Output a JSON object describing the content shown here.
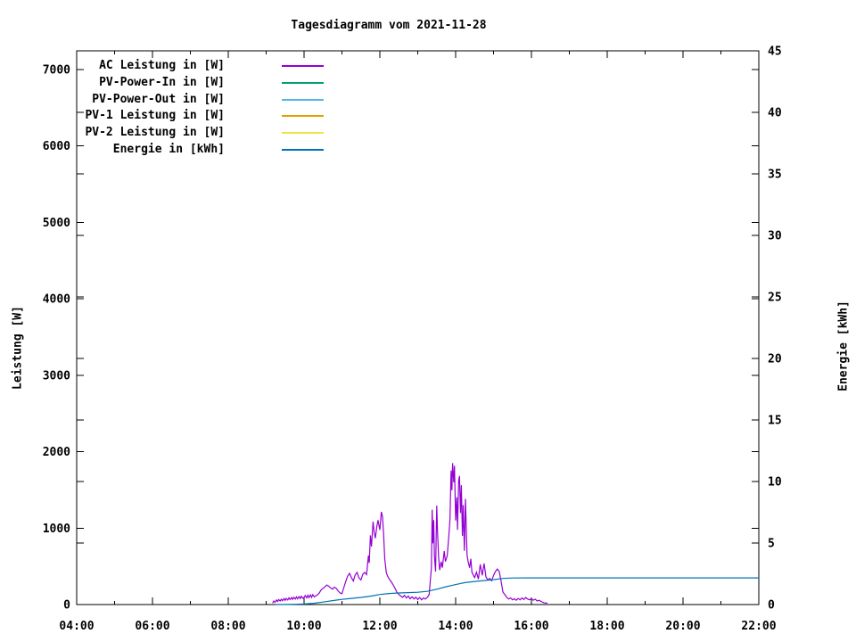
{
  "chart": {
    "title": "Tagesdiagramm vom 2021-11-28",
    "ylabel": "Leistung [W]",
    "y2label": "Energie [kWh]"
  },
  "chart_data": {
    "type": "line",
    "title": "Tagesdiagramm vom 2021-11-28",
    "xlabel": "",
    "ylabel": "Leistung [W]",
    "y2label": "Energie [kWh]",
    "x_axis": {
      "min_h": 4,
      "max_h": 22,
      "major_step_h": 2,
      "minor_step_h": 1,
      "tick_labels": [
        "04:00",
        "06:00",
        "08:00",
        "10:00",
        "12:00",
        "14:00",
        "16:00",
        "18:00",
        "20:00",
        "22:00"
      ]
    },
    "y_axis": {
      "min": 0,
      "max": 7245,
      "tick_step": 1000,
      "tick_labels": [
        "0",
        "1000",
        "2000",
        "3000",
        "4000",
        "5000",
        "6000",
        "7000"
      ],
      "tick_values": [
        0,
        1000,
        2000,
        3000,
        4000,
        5000,
        6000,
        7000
      ]
    },
    "y2_axis": {
      "min": 0,
      "max": 45,
      "tick_step": 5,
      "tick_labels": [
        "0",
        "5",
        "10",
        "15",
        "20",
        "25",
        "30",
        "35",
        "40",
        "45"
      ],
      "tick_values": [
        0,
        5,
        10,
        15,
        20,
        25,
        30,
        35,
        40,
        45
      ]
    },
    "grid": false,
    "legend_position": "top-left-inside",
    "legend": [
      {
        "label": "AC Leistung in [W]",
        "color": "#9400d3"
      },
      {
        "label": "PV-Power-In in [W]",
        "color": "#009e73"
      },
      {
        "label": "PV-Power-Out in [W]",
        "color": "#56b4e9"
      },
      {
        "label": "PV-1 Leistung in [W]",
        "color": "#e69f00"
      },
      {
        "label": "PV-2 Leistung in [W]",
        "color": "#f0e442"
      },
      {
        "label": "Energie in [kWh]",
        "color": "#0072b2"
      }
    ],
    "series": [
      {
        "name": "AC Leistung in [W]",
        "color": "#9400d3",
        "axis": "y1",
        "points": [
          [
            9.17,
            20
          ],
          [
            9.2,
            45
          ],
          [
            9.23,
            30
          ],
          [
            9.27,
            60
          ],
          [
            9.3,
            40
          ],
          [
            9.33,
            65
          ],
          [
            9.37,
            45
          ],
          [
            9.4,
            70
          ],
          [
            9.43,
            50
          ],
          [
            9.47,
            78
          ],
          [
            9.5,
            55
          ],
          [
            9.53,
            80
          ],
          [
            9.57,
            60
          ],
          [
            9.6,
            88
          ],
          [
            9.63,
            65
          ],
          [
            9.67,
            92
          ],
          [
            9.7,
            68
          ],
          [
            9.73,
            95
          ],
          [
            9.77,
            72
          ],
          [
            9.8,
            100
          ],
          [
            9.83,
            75
          ],
          [
            9.87,
            105
          ],
          [
            9.9,
            78
          ],
          [
            9.93,
            108
          ],
          [
            9.97,
            82
          ],
          [
            10.0,
            95
          ],
          [
            10.03,
            118
          ],
          [
            10.07,
            88
          ],
          [
            10.1,
            122
          ],
          [
            10.13,
            90
          ],
          [
            10.17,
            126
          ],
          [
            10.2,
            94
          ],
          [
            10.23,
            130
          ],
          [
            10.27,
            100
          ],
          [
            10.3,
            112
          ],
          [
            10.35,
            125
          ],
          [
            10.4,
            150
          ],
          [
            10.45,
            190
          ],
          [
            10.5,
            212
          ],
          [
            10.55,
            232
          ],
          [
            10.6,
            255
          ],
          [
            10.65,
            242
          ],
          [
            10.7,
            218
          ],
          [
            10.75,
            202
          ],
          [
            10.8,
            228
          ],
          [
            10.85,
            212
          ],
          [
            10.9,
            176
          ],
          [
            10.95,
            152
          ],
          [
            11.0,
            142
          ],
          [
            11.05,
            222
          ],
          [
            11.1,
            305
          ],
          [
            11.15,
            372
          ],
          [
            11.2,
            408
          ],
          [
            11.25,
            352
          ],
          [
            11.3,
            308
          ],
          [
            11.35,
            390
          ],
          [
            11.4,
            420
          ],
          [
            11.45,
            348
          ],
          [
            11.5,
            322
          ],
          [
            11.55,
            398
          ],
          [
            11.6,
            420
          ],
          [
            11.65,
            392
          ],
          [
            11.7,
            640
          ],
          [
            11.72,
            545
          ],
          [
            11.75,
            905
          ],
          [
            11.78,
            760
          ],
          [
            11.82,
            1085
          ],
          [
            11.85,
            948
          ],
          [
            11.88,
            868
          ],
          [
            11.92,
            1020
          ],
          [
            11.95,
            1105
          ],
          [
            12.0,
            978
          ],
          [
            12.04,
            1213
          ],
          [
            12.07,
            1148
          ],
          [
            12.1,
            898
          ],
          [
            12.13,
            598
          ],
          [
            12.17,
            420
          ],
          [
            12.2,
            378
          ],
          [
            12.25,
            332
          ],
          [
            12.3,
            298
          ],
          [
            12.35,
            258
          ],
          [
            12.4,
            212
          ],
          [
            12.45,
            162
          ],
          [
            12.5,
            132
          ],
          [
            12.55,
            112
          ],
          [
            12.6,
            95
          ],
          [
            12.65,
            120
          ],
          [
            12.7,
            86
          ],
          [
            12.75,
            112
          ],
          [
            12.8,
            76
          ],
          [
            12.85,
            102
          ],
          [
            12.9,
            72
          ],
          [
            12.95,
            96
          ],
          [
            13.0,
            66
          ],
          [
            13.05,
            92
          ],
          [
            13.1,
            62
          ],
          [
            13.15,
            86
          ],
          [
            13.2,
            72
          ],
          [
            13.25,
            92
          ],
          [
            13.3,
            130
          ],
          [
            13.33,
            300
          ],
          [
            13.36,
            480
          ],
          [
            13.38,
            1240
          ],
          [
            13.4,
            800
          ],
          [
            13.42,
            1105
          ],
          [
            13.44,
            640
          ],
          [
            13.47,
            432
          ],
          [
            13.5,
            1295
          ],
          [
            13.52,
            980
          ],
          [
            13.55,
            620
          ],
          [
            13.58,
            452
          ],
          [
            13.62,
            562
          ],
          [
            13.65,
            482
          ],
          [
            13.7,
            700
          ],
          [
            13.73,
            562
          ],
          [
            13.78,
            642
          ],
          [
            13.82,
            905
          ],
          [
            13.85,
            1102
          ],
          [
            13.88,
            1752
          ],
          [
            13.9,
            1495
          ],
          [
            13.92,
            1850
          ],
          [
            13.95,
            1598
          ],
          [
            13.97,
            1815
          ],
          [
            14.0,
            1100
          ],
          [
            14.03,
            1402
          ],
          [
            14.05,
            978
          ],
          [
            14.08,
            1622
          ],
          [
            14.1,
            1682
          ],
          [
            14.13,
            1198
          ],
          [
            14.15,
            1562
          ],
          [
            14.18,
            898
          ],
          [
            14.2,
            1302
          ],
          [
            14.23,
            702
          ],
          [
            14.26,
            1382
          ],
          [
            14.3,
            648
          ],
          [
            14.33,
            562
          ],
          [
            14.37,
            482
          ],
          [
            14.4,
            598
          ],
          [
            14.43,
            422
          ],
          [
            14.47,
            382
          ],
          [
            14.5,
            352
          ],
          [
            14.55,
            422
          ],
          [
            14.6,
            332
          ],
          [
            14.65,
            525
          ],
          [
            14.7,
            382
          ],
          [
            14.75,
            537
          ],
          [
            14.8,
            362
          ],
          [
            14.85,
            322
          ],
          [
            14.9,
            342
          ],
          [
            14.95,
            312
          ],
          [
            15.0,
            382
          ],
          [
            15.05,
            432
          ],
          [
            15.1,
            465
          ],
          [
            15.15,
            432
          ],
          [
            15.2,
            302
          ],
          [
            15.25,
            162
          ],
          [
            15.3,
            128
          ],
          [
            15.35,
            92
          ],
          [
            15.4,
            72
          ],
          [
            15.45,
            86
          ],
          [
            15.5,
            62
          ],
          [
            15.55,
            76
          ],
          [
            15.6,
            56
          ],
          [
            15.65,
            80
          ],
          [
            15.7,
            62
          ],
          [
            15.75,
            86
          ],
          [
            15.8,
            66
          ],
          [
            15.85,
            92
          ],
          [
            15.9,
            72
          ],
          [
            15.95,
            62
          ],
          [
            16.0,
            76
          ],
          [
            16.05,
            56
          ],
          [
            16.1,
            70
          ],
          [
            16.15,
            46
          ],
          [
            16.2,
            56
          ],
          [
            16.27,
            36
          ],
          [
            16.33,
            22
          ],
          [
            16.42,
            18
          ]
        ]
      },
      {
        "name": "PV-Power-In in [W]",
        "color": "#009e73",
        "axis": "y1",
        "points": []
      },
      {
        "name": "PV-Power-Out in [W]",
        "color": "#56b4e9",
        "axis": "y1",
        "points": []
      },
      {
        "name": "PV-1 Leistung in [W]",
        "color": "#e69f00",
        "axis": "y1",
        "points": []
      },
      {
        "name": "PV-2 Leistung in [W]",
        "color": "#f0e442",
        "axis": "y1",
        "points": []
      },
      {
        "name": "Energie in [kWh]",
        "color": "#0072b2",
        "axis": "y2",
        "points": [
          [
            9.25,
            0.0
          ],
          [
            9.5,
            0.01
          ],
          [
            9.75,
            0.02
          ],
          [
            10.0,
            0.05
          ],
          [
            10.25,
            0.1
          ],
          [
            10.5,
            0.2
          ],
          [
            10.75,
            0.32
          ],
          [
            11.0,
            0.42
          ],
          [
            11.25,
            0.5
          ],
          [
            11.5,
            0.58
          ],
          [
            11.75,
            0.68
          ],
          [
            12.0,
            0.82
          ],
          [
            12.25,
            0.9
          ],
          [
            12.5,
            0.94
          ],
          [
            12.75,
            0.97
          ],
          [
            13.0,
            1.0
          ],
          [
            13.25,
            1.07
          ],
          [
            13.5,
            1.25
          ],
          [
            13.75,
            1.45
          ],
          [
            14.0,
            1.62
          ],
          [
            14.25,
            1.78
          ],
          [
            14.5,
            1.88
          ],
          [
            14.75,
            1.95
          ],
          [
            15.0,
            2.02
          ],
          [
            15.25,
            2.12
          ],
          [
            15.5,
            2.16
          ],
          [
            16.0,
            2.17
          ],
          [
            22.0,
            2.17
          ]
        ]
      }
    ]
  }
}
